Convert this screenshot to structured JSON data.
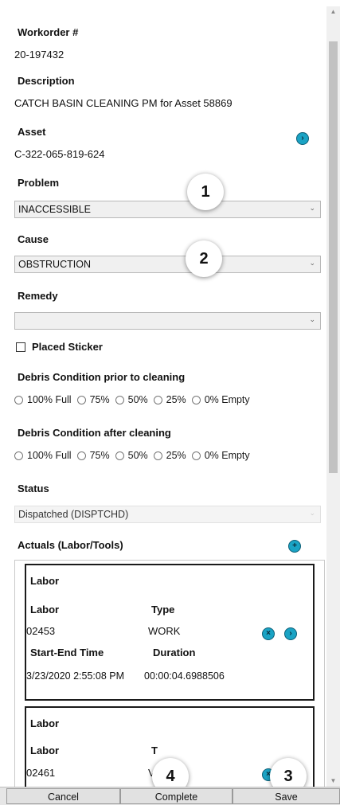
{
  "workorder": {
    "label": "Workorder #",
    "value": "20-197432"
  },
  "description": {
    "label": "Description",
    "value": "CATCH BASIN CLEANING PM for Asset 58869"
  },
  "asset": {
    "label": "Asset",
    "value": "C-322-065-819-624"
  },
  "problem": {
    "label": "Problem",
    "value": "INACCESSIBLE"
  },
  "cause": {
    "label": "Cause",
    "value": "OBSTRUCTION"
  },
  "remedy": {
    "label": "Remedy",
    "value": ""
  },
  "placed_sticker": {
    "label": "Placed Sticker",
    "checked": false
  },
  "debris_prior": {
    "label": "Debris Condition prior to cleaning",
    "options": [
      "100% Full",
      "75%",
      "50%",
      "25%",
      "0% Empty"
    ]
  },
  "debris_after": {
    "label": "Debris Condition after cleaning",
    "options": [
      "100% Full",
      "75%",
      "50%",
      "25%",
      "0% Empty"
    ]
  },
  "status": {
    "label": "Status",
    "value": "Dispatched (DISPTCHD)"
  },
  "actuals": {
    "label": "Actuals (Labor/Tools)",
    "cards": [
      {
        "title": "Labor",
        "labor_label": "Labor",
        "labor_value": "02453",
        "type_label": "Type",
        "type_value": "WORK",
        "time_label": "Start-End Time",
        "duration_label": "Duration",
        "time_value": "3/23/2020 2:55:08 PM",
        "duration_value": "00:00:04.6988506"
      },
      {
        "title": "Labor",
        "labor_label": "Labor",
        "labor_value": "02461",
        "type_label": "T",
        "type_value": "V"
      }
    ]
  },
  "callouts": [
    "1",
    "2",
    "3",
    "4"
  ],
  "buttons": {
    "cancel": "Cancel",
    "complete": "Complete",
    "save": "Save"
  },
  "colors": {
    "accent_icon": "#1aa3c4",
    "card_border": "#1b1b1b"
  }
}
